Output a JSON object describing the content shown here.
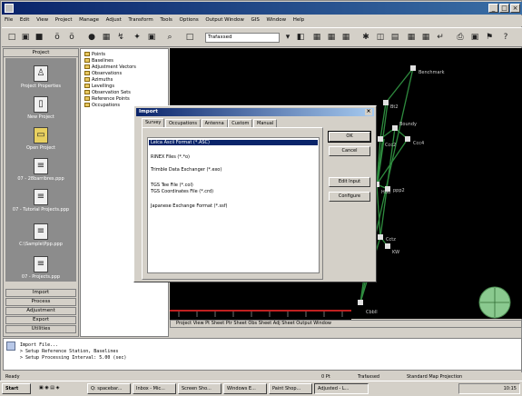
{
  "window": {
    "title": "",
    "min": "_",
    "max": "□",
    "close": "×"
  },
  "menu": [
    "File",
    "Edit",
    "View",
    "Project",
    "Manage",
    "Adjust",
    "Transform",
    "Tools",
    "Options",
    "Output Window",
    "GIS",
    "Window",
    "Help"
  ],
  "toolbar": {
    "combo_value": "Trafaxsed"
  },
  "left_panel": {
    "header": "Project",
    "items": [
      {
        "label": "Project Properties",
        "icon": "project-properties-icon"
      },
      {
        "label": "New Project",
        "icon": "new-project-icon"
      },
      {
        "label": "Open Project",
        "icon": "open-project-icon"
      },
      {
        "label": "07 - 28barribres.ppp",
        "icon": "project-file-icon"
      },
      {
        "label": "07 - Tutorial \nProjects.ppp",
        "icon": "project-file-icon"
      },
      {
        "label": "C:\\Sample\\Ppp.ppp",
        "icon": "project-file-icon"
      },
      {
        "label": "07 - Projects.ppp",
        "icon": "project-file-icon"
      }
    ],
    "buttons": [
      "Import",
      "Process",
      "Adjustment",
      "Export",
      "Utilities"
    ]
  },
  "tree": [
    "Points",
    "Baselines",
    "Adjustment Vectors",
    "Observations",
    "Azimuths",
    "Levellings",
    "Observation Sets",
    "Reference Points",
    "Occupations"
  ],
  "canvas": {
    "labels": [
      "Benchmark",
      "Bt2",
      "Boundy",
      "Ccc4",
      "Ccc2",
      "Hdd",
      "ppp2",
      "Cctz",
      "KW",
      "Cbbll"
    ],
    "bg_color": "#000000",
    "link_color": "#2e8b3e",
    "node_color": "#e0e0e0",
    "footer_tabs": "Project View  Pt Sheet  Ptr Sheet  Obs Sheet  Adj Sheet  Output Window"
  },
  "command_window": {
    "lines": [
      "Import File...",
      "> Setup Reference Station, Baselines",
      "> Setup Processing Interval: 5.00 (sec)"
    ]
  },
  "app_status": {
    "left": "Ready",
    "mid1": "0 Pt",
    "mid2": "Trafaxsed",
    "right": "Standard Map Projection"
  },
  "dialog": {
    "title": "Import",
    "tabs": [
      "Survey",
      "Occupations",
      "Antenna",
      "Custom",
      "Manual"
    ],
    "active_tab": 0,
    "items": [
      "Leica Ascii Format (*.ASC)",
      "RINEX Files (*.*o)",
      "Trimble Data Exchanger (*.exo)",
      "TGS Tee File (*.col)",
      "TGS Coordinates File (*.crd)",
      "Japanese Exchange Format (*.ssf)"
    ],
    "buttons": {
      "ok": "OK",
      "cancel": "Cancel",
      "edit_input": "Edit Input",
      "configure": "Configure"
    }
  },
  "taskbar": {
    "start": "Start",
    "tasks": [
      "Q: spacebar...",
      "Inbox - Mic...",
      "Screen Sho...",
      "Windows E...",
      "Paint Shop...",
      "Adjusted - L..."
    ],
    "tray_time": "10:15"
  }
}
